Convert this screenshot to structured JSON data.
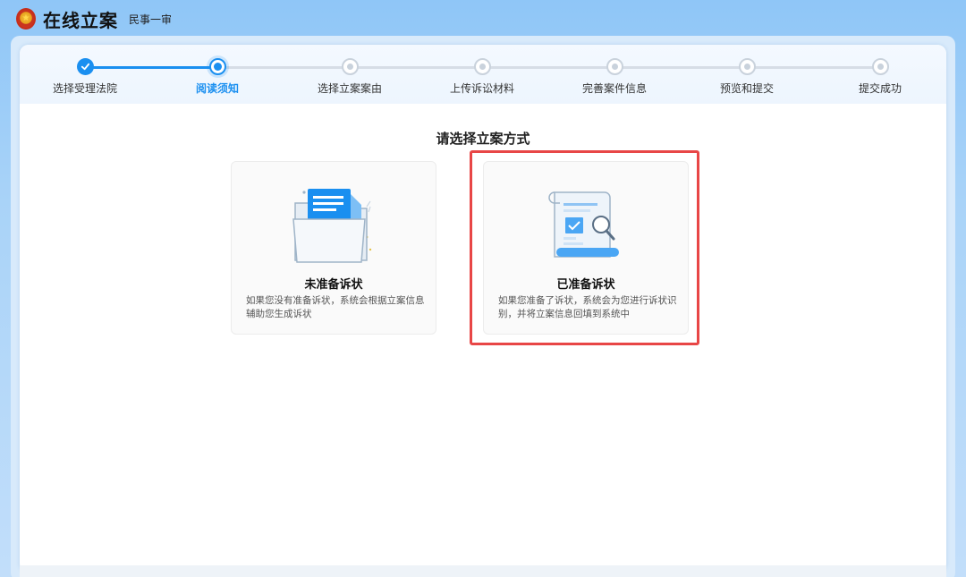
{
  "header": {
    "title": "在线立案",
    "subtitle": "民事一审"
  },
  "steps": [
    {
      "label": "选择受理法院",
      "state": "done"
    },
    {
      "label": "阅读须知",
      "state": "current"
    },
    {
      "label": "选择立案案由",
      "state": "todo"
    },
    {
      "label": "上传诉讼材料",
      "state": "todo"
    },
    {
      "label": "完善案件信息",
      "state": "todo"
    },
    {
      "label": "预览和提交",
      "state": "todo"
    },
    {
      "label": "提交成功",
      "state": "todo"
    }
  ],
  "main": {
    "title": "请选择立案方式",
    "options": [
      {
        "title": "未准备诉状",
        "description": "如果您没有准备诉状，系统会根据立案信息辅助您生成诉状",
        "icon": "folder-document-icon"
      },
      {
        "title": "已准备诉状",
        "description": "如果您准备了诉状，系统会为您进行诉状识别，并将立案信息回填到系统中",
        "icon": "document-scan-icon",
        "highlighted": true
      }
    ]
  },
  "colors": {
    "accent": "#1a8ff0",
    "highlight": "#e84646"
  }
}
